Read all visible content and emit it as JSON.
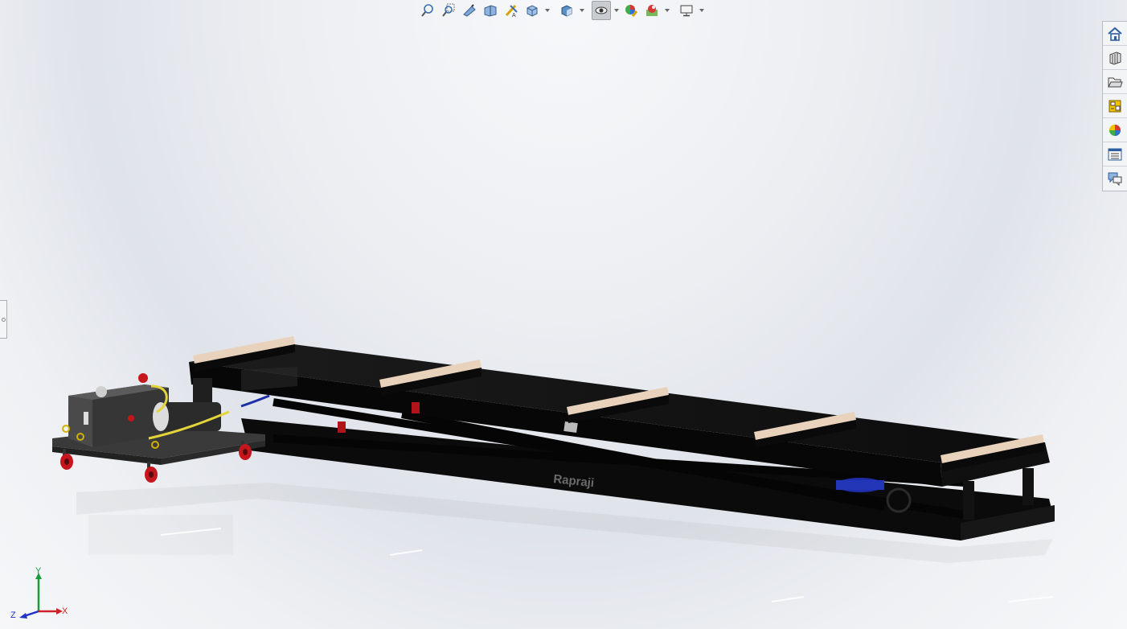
{
  "heads_up_toolbar": {
    "buttons": [
      {
        "icon": "zoom-to-fit-icon"
      },
      {
        "icon": "zoom-to-area-icon"
      },
      {
        "icon": "previous-view-icon"
      },
      {
        "icon": "section-view-icon"
      },
      {
        "icon": "dynamic-annotation-views-icon"
      },
      {
        "icon": "view-orientation-icon",
        "has_dropdown": true
      },
      {
        "icon": "display-style-icon",
        "has_dropdown": true
      },
      {
        "icon": "hide-show-items-icon",
        "has_dropdown": true,
        "active": true
      },
      {
        "icon": "edit-appearance-icon"
      },
      {
        "icon": "apply-scene-icon",
        "has_dropdown": true
      },
      {
        "icon": "view-settings-icon",
        "has_dropdown": true
      }
    ]
  },
  "task_pane": {
    "tabs": [
      {
        "icon": "solidworks-resources-icon"
      },
      {
        "icon": "design-library-icon"
      },
      {
        "icon": "file-explorer-icon"
      },
      {
        "icon": "view-palette-icon"
      },
      {
        "icon": "appearances-scenes-decals-icon"
      },
      {
        "icon": "custom-properties-icon"
      },
      {
        "icon": "solidworks-forum-icon"
      }
    ]
  },
  "model": {
    "brand_label": "Rapraji",
    "colors": {
      "frame": "#0b0b0b",
      "deck": "#141414",
      "wheels": "#c4161c",
      "hose": "#e3d43a",
      "pads": "#e8d2bc",
      "cylinder": "#1e2ea8",
      "cart_plate": "#3a3a3a"
    }
  },
  "triad": {
    "x_label": "X",
    "y_label": "Y",
    "z_label": "Z",
    "colors": {
      "x": "#d0202a",
      "y": "#1c9a3a",
      "z": "#2034c8"
    }
  }
}
